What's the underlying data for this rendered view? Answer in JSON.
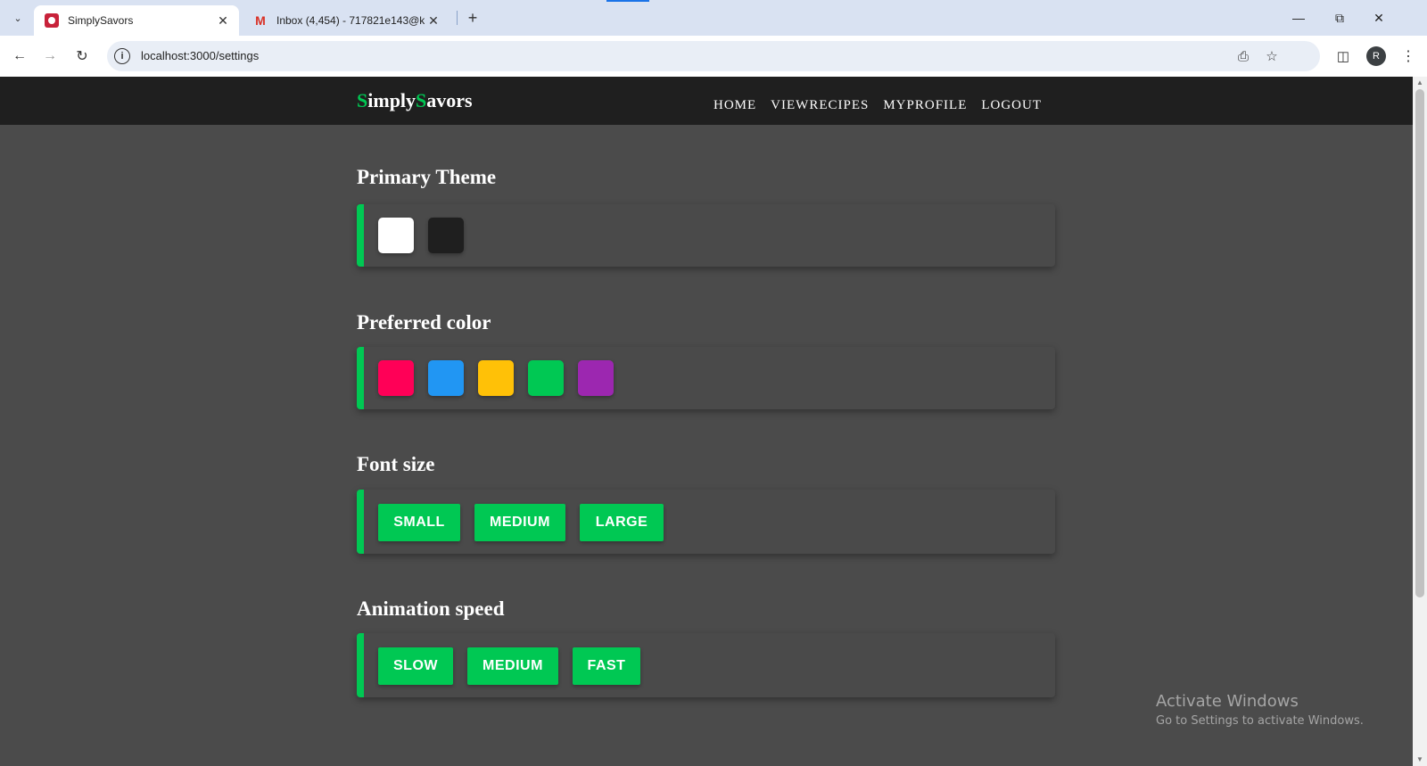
{
  "browser": {
    "tabs": [
      {
        "title": "SimplySavors",
        "active": true
      },
      {
        "title": "Inbox (4,454) - 717821e143@k",
        "active": false
      }
    ],
    "url": "localhost:3000/settings",
    "profile_initial": "R"
  },
  "site": {
    "brand": {
      "s1": "S",
      "part1": "imply",
      "s2": "S",
      "part2": "avors"
    },
    "nav": [
      "HOME",
      "VIEWRECIPES",
      "MYPROFILE",
      "LOGOUT"
    ],
    "accent_color": "#00c853"
  },
  "settings": {
    "primary_theme": {
      "title": "Primary Theme",
      "options": [
        {
          "name": "light",
          "color": "#ffffff"
        },
        {
          "name": "dark",
          "color": "#1f1f1f"
        }
      ]
    },
    "preferred_color": {
      "title": "Preferred color",
      "options": [
        {
          "name": "pink",
          "color": "#ff0057"
        },
        {
          "name": "blue",
          "color": "#2196f3"
        },
        {
          "name": "yellow",
          "color": "#ffc107"
        },
        {
          "name": "green",
          "color": "#00c853"
        },
        {
          "name": "purple",
          "color": "#9c27b0"
        }
      ]
    },
    "font_size": {
      "title": "Font size",
      "options": [
        "SMALL",
        "MEDIUM",
        "LARGE"
      ]
    },
    "animation_speed": {
      "title": "Animation speed",
      "options": [
        "SLOW",
        "MEDIUM",
        "FAST"
      ]
    }
  },
  "watermark": {
    "line1": "Activate Windows",
    "line2": "Go to Settings to activate Windows."
  }
}
